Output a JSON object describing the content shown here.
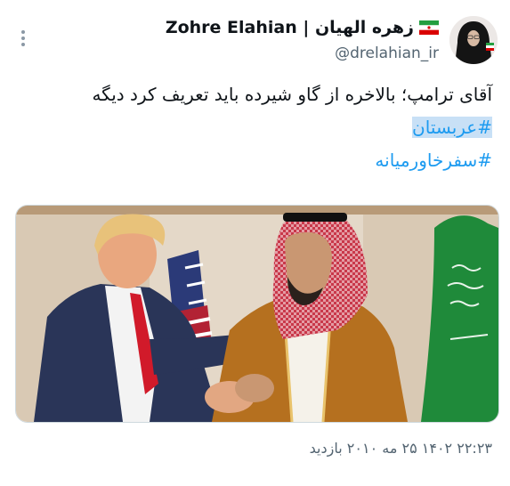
{
  "author": {
    "display_name": "Zohre Elahian | زهره الهیان",
    "handle": "@drelahian_ir",
    "avatar_icon": "profile-photo",
    "flag_icon": "iran-flag-icon"
  },
  "menu": {
    "icon": "more-vertical-icon"
  },
  "tweet": {
    "line1": "آقای ترامپ؛ بالاخره از گاو شیرده باید تعریف کرد دیگه",
    "hashtag1": "#عربستان",
    "hashtag2": "#سفرخاورمیانه"
  },
  "media": {
    "type": "photo"
  },
  "meta": {
    "timestamp": "۲۲:۲۳ ۱۴۰۲ ۲۵ مه ۲۰۱۰ بازدید"
  },
  "colors": {
    "link": "#1d9bf0",
    "secondary_text": "#536471",
    "hashtag_highlight": "#c8e0f6"
  }
}
